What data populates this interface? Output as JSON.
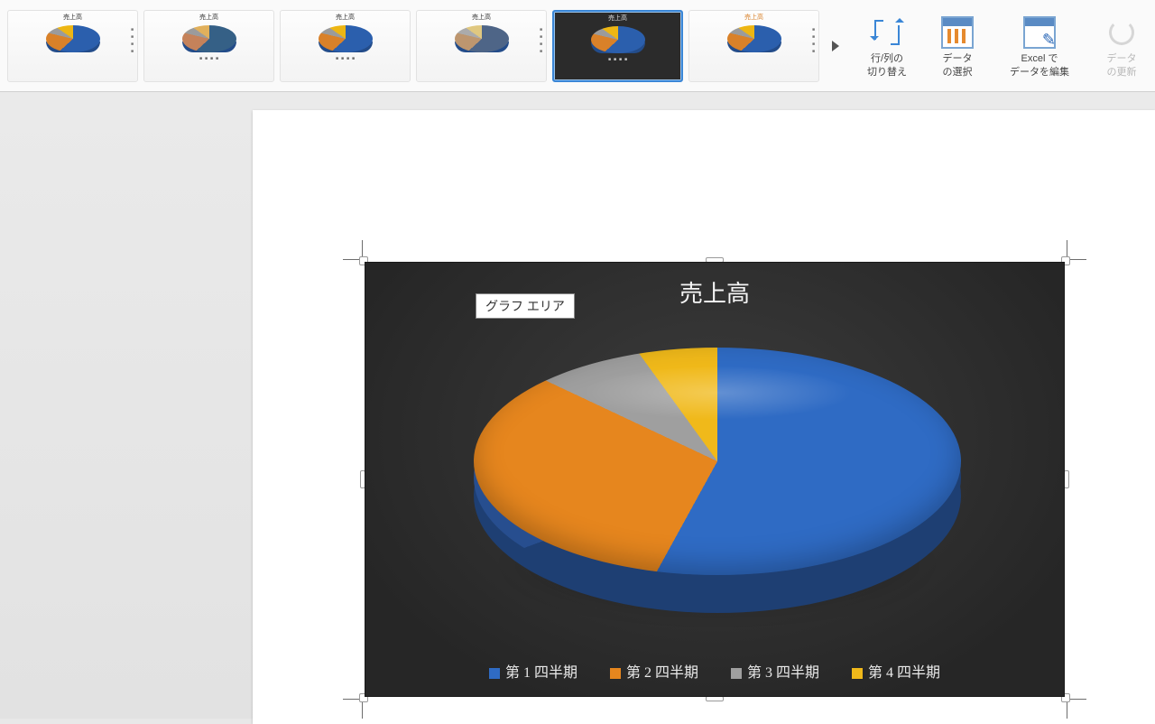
{
  "ribbon": {
    "styles_title_common": "売上高",
    "commands": {
      "switch_rows_cols": "行/列の\n切り替え",
      "select_data": "データ\nの選択",
      "edit_in_excel": "Excel で\nデータを編集",
      "refresh_data": "データ\nの更新"
    }
  },
  "chart": {
    "title": "売上高",
    "plot_area_label": "グラフ エリア",
    "legend": [
      "第 1 四半期",
      "第 2 四半期",
      "第 3 四半期",
      "第 4 四半期"
    ],
    "colors": [
      "#2f6bc4",
      "#e6861e",
      "#9f9f9f",
      "#f0b91a"
    ]
  },
  "chart_data": {
    "type": "pie",
    "title": "売上高",
    "categories": [
      "第 1 四半期",
      "第 2 四半期",
      "第 3 四半期",
      "第 4 四半期"
    ],
    "values": [
      58,
      24,
      8,
      10
    ],
    "colors": [
      "#2f6bc4",
      "#e6861e",
      "#9f9f9f",
      "#f0b91a"
    ],
    "style": "3d-dark"
  }
}
